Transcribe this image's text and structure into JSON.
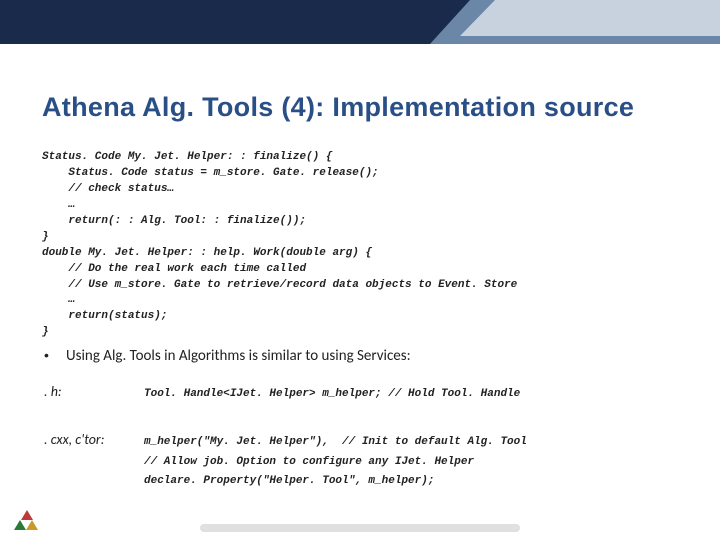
{
  "title": "Athena Alg. Tools (4): Implementation source",
  "code_block": "Status. Code My. Jet. Helper: : finalize() {\n    Status. Code status = m_store. Gate. release();\n    // check status…\n    …\n    return(: : Alg. Tool: : finalize());\n}\ndouble My. Jet. Helper: : help. Work(double arg) {\n    // Do the real work each time called\n    // Use m_store. Gate to retrieve/record data objects to Event. Store\n    …\n    return(status);\n}",
  "bullet": {
    "dot": "•",
    "text": "Using Alg. Tools in Algorithms is similar to using Services:"
  },
  "files": {
    "h": {
      "label": ". h:",
      "code": "Tool. Handle<IJet. Helper> m_helper; // Hold Tool. Handle"
    },
    "cxx": {
      "label": ". cxx, c'tor:",
      "code": "m_helper(\"My. Jet. Helper\"),  // Init to default Alg. Tool\n// Allow job. Option to configure any IJet. Helper\ndeclare. Property(\"Helper. Tool\", m_helper);"
    }
  }
}
